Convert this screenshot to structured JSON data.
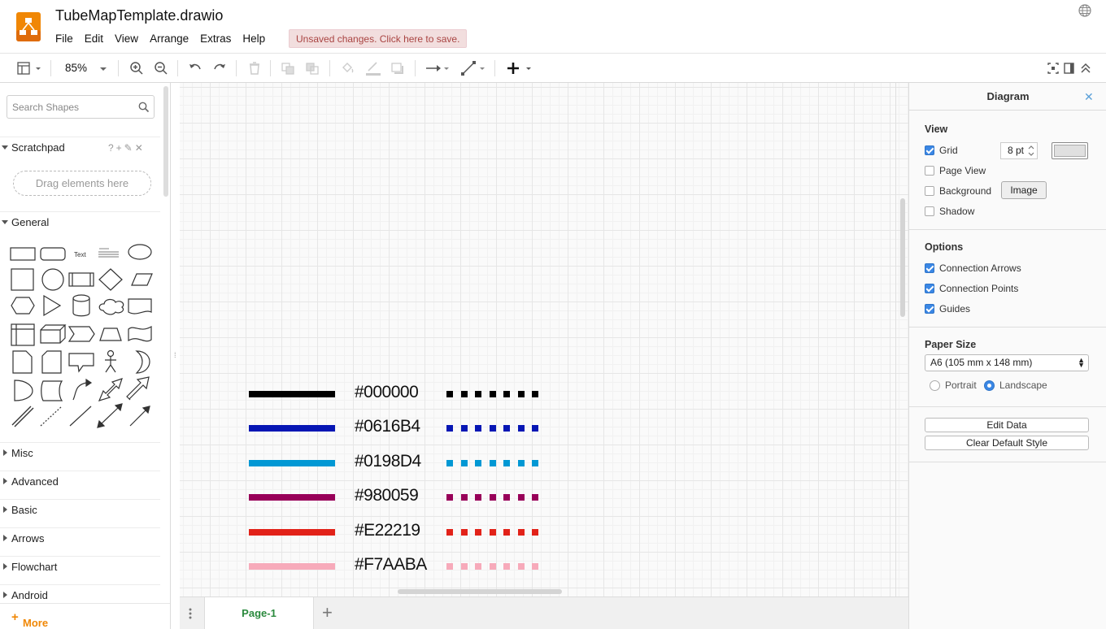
{
  "app": {
    "file_title": "TubeMapTemplate.drawio",
    "menus": [
      "File",
      "Edit",
      "View",
      "Arrange",
      "Extras",
      "Help"
    ],
    "unsaved_notice": "Unsaved changes. Click here to save.",
    "accent": "#f08705"
  },
  "toolbar": {
    "zoom": "85%"
  },
  "sidebar": {
    "search_placeholder": "Search Shapes",
    "scratchpad_label": "Scratchpad",
    "scratchpad_actions": "?+✎✕",
    "drag_hint": "Drag elements here",
    "general_label": "General",
    "text_shape_label": "Text",
    "sections": [
      "Misc",
      "Advanced",
      "Basic",
      "Arrows",
      "Flowchart",
      "Android"
    ],
    "more_shapes": "More Shapes..."
  },
  "canvas": {
    "lines": [
      {
        "label": "#000000",
        "color": "#000000"
      },
      {
        "label": "#0616B4",
        "color": "#0616B4"
      },
      {
        "label": "#0198D4",
        "color": "#0198D4"
      },
      {
        "label": "#980059",
        "color": "#980059"
      },
      {
        "label": "#E22219",
        "color": "#E22219"
      },
      {
        "label": "#F7AABA",
        "color": "#F7AABA"
      }
    ]
  },
  "pages": {
    "current": "Page-1"
  },
  "format_panel": {
    "title": "Diagram",
    "view_title": "View",
    "grid_label": "Grid",
    "grid_checked": true,
    "grid_size": "8 pt",
    "page_view_label": "Page View",
    "background_label": "Background",
    "image_button": "Image",
    "shadow_label": "Shadow",
    "options_title": "Options",
    "connection_arrows_label": "Connection Arrows",
    "connection_points_label": "Connection Points",
    "guides_label": "Guides",
    "paper_size_title": "Paper Size",
    "paper_size_value": "A6 (105 mm x 148 mm)",
    "portrait_label": "Portrait",
    "landscape_label": "Landscape",
    "orientation": "Landscape",
    "edit_data_button": "Edit Data",
    "clear_style_button": "Clear Default Style"
  }
}
